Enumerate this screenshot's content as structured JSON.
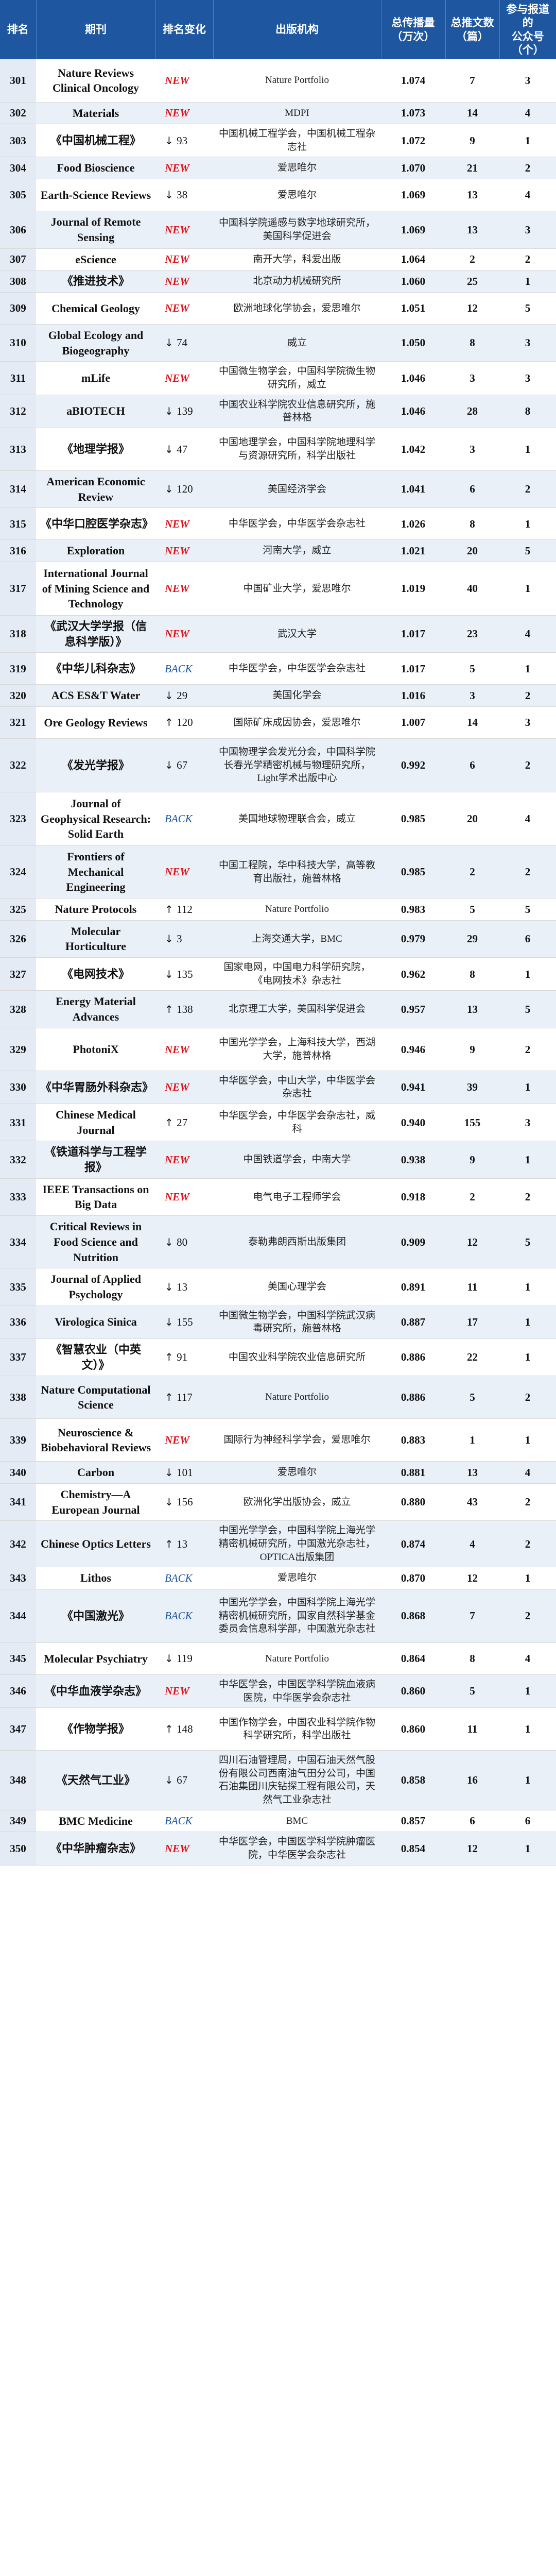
{
  "header": {
    "rank": "排名",
    "journal": "期刊",
    "change": "排名变化",
    "publisher": "出版机构",
    "score": "总传播量\n（万次）",
    "count": "总推文数\n（篇）",
    "accounts": "参与报道的\n公众号\n（个）"
  },
  "rows": [
    {
      "rank": "301",
      "journal": "Nature Reviews Clinical Oncology",
      "change_type": "new",
      "change_text": "NEW",
      "publisher": "Nature Portfolio",
      "score": "1.074",
      "count": "7",
      "accounts": "3"
    },
    {
      "rank": "302",
      "journal": "Materials",
      "change_type": "new",
      "change_text": "NEW",
      "publisher": "MDPI",
      "score": "1.073",
      "count": "14",
      "accounts": "4"
    },
    {
      "rank": "303",
      "journal": "《中国机械工程》",
      "change_type": "down",
      "change_text": "93",
      "publisher": "中国机械工程学会，中国机械工程杂志社",
      "score": "1.072",
      "count": "9",
      "accounts": "1"
    },
    {
      "rank": "304",
      "journal": "Food Bioscience",
      "change_type": "new",
      "change_text": "NEW",
      "publisher": "爱思唯尔",
      "score": "1.070",
      "count": "21",
      "accounts": "2"
    },
    {
      "rank": "305",
      "journal": "Earth-Science Reviews",
      "change_type": "down",
      "change_text": "38",
      "publisher": "爱思唯尔",
      "score": "1.069",
      "count": "13",
      "accounts": "4"
    },
    {
      "rank": "306",
      "journal": "Journal of Remote Sensing",
      "change_type": "new",
      "change_text": "NEW",
      "publisher": "中国科学院遥感与数字地球研究所，美国科学促进会",
      "score": "1.069",
      "count": "13",
      "accounts": "3"
    },
    {
      "rank": "307",
      "journal": "eScience",
      "change_type": "new",
      "change_text": "NEW",
      "publisher": "南开大学，科爱出版",
      "score": "1.064",
      "count": "2",
      "accounts": "2"
    },
    {
      "rank": "308",
      "journal": "《推进技术》",
      "change_type": "new",
      "change_text": "NEW",
      "publisher": "北京动力机械研究所",
      "score": "1.060",
      "count": "25",
      "accounts": "1"
    },
    {
      "rank": "309",
      "journal": "Chemical Geology",
      "change_type": "new",
      "change_text": "NEW",
      "publisher": "欧洲地球化学协会，爱思唯尔",
      "score": "1.051",
      "count": "12",
      "accounts": "5"
    },
    {
      "rank": "310",
      "journal": "Global Ecology and Biogeography",
      "change_type": "down",
      "change_text": "74",
      "publisher": "威立",
      "score": "1.050",
      "count": "8",
      "accounts": "3"
    },
    {
      "rank": "311",
      "journal": "mLife",
      "change_type": "new",
      "change_text": "NEW",
      "publisher": "中国微生物学会，中国科学院微生物研究所，威立",
      "score": "1.046",
      "count": "3",
      "accounts": "3"
    },
    {
      "rank": "312",
      "journal": "aBIOTECH",
      "change_type": "down",
      "change_text": "139",
      "publisher": "中国农业科学院农业信息研究所，施普林格",
      "score": "1.046",
      "count": "28",
      "accounts": "8"
    },
    {
      "rank": "313",
      "journal": "《地理学报》",
      "change_type": "down",
      "change_text": "47",
      "publisher": "中国地理学会，中国科学院地理科学与资源研究所，科学出版社",
      "score": "1.042",
      "count": "3",
      "accounts": "1"
    },
    {
      "rank": "314",
      "journal": "American Economic Review",
      "change_type": "down",
      "change_text": "120",
      "publisher": "美国经济学会",
      "score": "1.041",
      "count": "6",
      "accounts": "2"
    },
    {
      "rank": "315",
      "journal": "《中华口腔医学杂志》",
      "change_type": "new",
      "change_text": "NEW",
      "publisher": "中华医学会，中华医学会杂志社",
      "score": "1.026",
      "count": "8",
      "accounts": "1"
    },
    {
      "rank": "316",
      "journal": "Exploration",
      "change_type": "new",
      "change_text": "NEW",
      "publisher": "河南大学，威立",
      "score": "1.021",
      "count": "20",
      "accounts": "5"
    },
    {
      "rank": "317",
      "journal": "International Journal of Mining Science and Technology",
      "change_type": "new",
      "change_text": "NEW",
      "publisher": "中国矿业大学，爱思唯尔",
      "score": "1.019",
      "count": "40",
      "accounts": "1"
    },
    {
      "rank": "318",
      "journal": "《武汉大学学报（信息科学版）》",
      "change_type": "new",
      "change_text": "NEW",
      "publisher": "武汉大学",
      "score": "1.017",
      "count": "23",
      "accounts": "4"
    },
    {
      "rank": "319",
      "journal": "《中华儿科杂志》",
      "change_type": "back",
      "change_text": "BACK",
      "publisher": "中华医学会，中华医学会杂志社",
      "score": "1.017",
      "count": "5",
      "accounts": "1"
    },
    {
      "rank": "320",
      "journal": "ACS ES&T Water",
      "change_type": "down",
      "change_text": "29",
      "publisher": "美国化学会",
      "score": "1.016",
      "count": "3",
      "accounts": "2"
    },
    {
      "rank": "321",
      "journal": "Ore Geology Reviews",
      "change_type": "up",
      "change_text": "120",
      "publisher": "国际矿床成因协会，爱思唯尔",
      "score": "1.007",
      "count": "14",
      "accounts": "3"
    },
    {
      "rank": "322",
      "journal": "《发光学报》",
      "change_type": "down",
      "change_text": "67",
      "publisher": "中国物理学会发光分会，中国科学院长春光学精密机械与物理研究所，Light学术出版中心",
      "score": "0.992",
      "count": "6",
      "accounts": "2"
    },
    {
      "rank": "323",
      "journal": "Journal of Geophysical Research: Solid Earth",
      "change_type": "back",
      "change_text": "BACK",
      "publisher": "美国地球物理联合会，威立",
      "score": "0.985",
      "count": "20",
      "accounts": "4"
    },
    {
      "rank": "324",
      "journal": "Frontiers of Mechanical Engineering",
      "change_type": "new",
      "change_text": "NEW",
      "publisher": "中国工程院，华中科技大学，高等教育出版社，施普林格",
      "score": "0.985",
      "count": "2",
      "accounts": "2"
    },
    {
      "rank": "325",
      "journal": "Nature Protocols",
      "change_type": "up",
      "change_text": "112",
      "publisher": "Nature Portfolio",
      "score": "0.983",
      "count": "5",
      "accounts": "5"
    },
    {
      "rank": "326",
      "journal": "Molecular Horticulture",
      "change_type": "down",
      "change_text": "3",
      "publisher": "上海交通大学，BMC",
      "score": "0.979",
      "count": "29",
      "accounts": "6"
    },
    {
      "rank": "327",
      "journal": "《电网技术》",
      "change_type": "down",
      "change_text": "135",
      "publisher": "国家电网，中国电力科学研究院，《电网技术》杂志社",
      "score": "0.962",
      "count": "8",
      "accounts": "1"
    },
    {
      "rank": "328",
      "journal": "Energy Material Advances",
      "change_type": "up",
      "change_text": "138",
      "publisher": "北京理工大学，美国科学促进会",
      "score": "0.957",
      "count": "13",
      "accounts": "5"
    },
    {
      "rank": "329",
      "journal": "PhotoniX",
      "change_type": "new",
      "change_text": "NEW",
      "publisher": "中国光学学会，上海科技大学，西湖大学，施普林格",
      "score": "0.946",
      "count": "9",
      "accounts": "2"
    },
    {
      "rank": "330",
      "journal": "《中华胃肠外科杂志》",
      "change_type": "new",
      "change_text": "NEW",
      "publisher": "中华医学会，中山大学，中华医学会杂志社",
      "score": "0.941",
      "count": "39",
      "accounts": "1"
    },
    {
      "rank": "331",
      "journal": "Chinese Medical Journal",
      "change_type": "up",
      "change_text": "27",
      "publisher": "中华医学会，中华医学会杂志社，威科",
      "score": "0.940",
      "count": "155",
      "accounts": "3"
    },
    {
      "rank": "332",
      "journal": "《铁道科学与工程学报》",
      "change_type": "new",
      "change_text": "NEW",
      "publisher": "中国铁道学会，中南大学",
      "score": "0.938",
      "count": "9",
      "accounts": "1"
    },
    {
      "rank": "333",
      "journal": "IEEE Transactions on Big Data",
      "change_type": "new",
      "change_text": "NEW",
      "publisher": "电气电子工程师学会",
      "score": "0.918",
      "count": "2",
      "accounts": "2"
    },
    {
      "rank": "334",
      "journal": "Critical Reviews in Food Science and Nutrition",
      "change_type": "down",
      "change_text": "80",
      "publisher": "泰勒弗朗西斯出版集团",
      "score": "0.909",
      "count": "12",
      "accounts": "5"
    },
    {
      "rank": "335",
      "journal": "Journal of Applied Psychology",
      "change_type": "down",
      "change_text": "13",
      "publisher": "美国心理学会",
      "score": "0.891",
      "count": "11",
      "accounts": "1"
    },
    {
      "rank": "336",
      "journal": "Virologica Sinica",
      "change_type": "down",
      "change_text": "155",
      "publisher": "中国微生物学会，中国科学院武汉病毒研究所，施普林格",
      "score": "0.887",
      "count": "17",
      "accounts": "1"
    },
    {
      "rank": "337",
      "journal": "《智慧农业（中英文）》",
      "change_type": "up",
      "change_text": "91",
      "publisher": "中国农业科学院农业信息研究所",
      "score": "0.886",
      "count": "22",
      "accounts": "1"
    },
    {
      "rank": "338",
      "journal": "Nature Computational Science",
      "change_type": "up",
      "change_text": "117",
      "publisher": "Nature Portfolio",
      "score": "0.886",
      "count": "5",
      "accounts": "2"
    },
    {
      "rank": "339",
      "journal": "Neuroscience & Biobehavioral Reviews",
      "change_type": "new",
      "change_text": "NEW",
      "publisher": "国际行为神经科学学会，爱思唯尔",
      "score": "0.883",
      "count": "1",
      "accounts": "1"
    },
    {
      "rank": "340",
      "journal": "Carbon",
      "change_type": "down",
      "change_text": "101",
      "publisher": "爱思唯尔",
      "score": "0.881",
      "count": "13",
      "accounts": "4"
    },
    {
      "rank": "341",
      "journal": "Chemistry—A European Journal",
      "change_type": "down",
      "change_text": "156",
      "publisher": "欧洲化学出版协会，威立",
      "score": "0.880",
      "count": "43",
      "accounts": "2"
    },
    {
      "rank": "342",
      "journal": "Chinese Optics Letters",
      "change_type": "up",
      "change_text": "13",
      "publisher": "中国光学学会，中国科学院上海光学精密机械研究所，中国激光杂志社，OPTICA出版集团",
      "score": "0.874",
      "count": "4",
      "accounts": "2"
    },
    {
      "rank": "343",
      "journal": "Lithos",
      "change_type": "back",
      "change_text": "BACK",
      "publisher": "爱思唯尔",
      "score": "0.870",
      "count": "12",
      "accounts": "1"
    },
    {
      "rank": "344",
      "journal": "《中国激光》",
      "change_type": "back",
      "change_text": "BACK",
      "publisher": "中国光学学会，中国科学院上海光学精密机械研究所，国家自然科学基金委员会信息科学部，中国激光杂志社",
      "score": "0.868",
      "count": "7",
      "accounts": "2"
    },
    {
      "rank": "345",
      "journal": "Molecular Psychiatry",
      "change_type": "down",
      "change_text": "119",
      "publisher": "Nature Portfolio",
      "score": "0.864",
      "count": "8",
      "accounts": "4"
    },
    {
      "rank": "346",
      "journal": "《中华血液学杂志》",
      "change_type": "new",
      "change_text": "NEW",
      "publisher": "中华医学会，中国医学科学院血液病医院，中华医学会杂志社",
      "score": "0.860",
      "count": "5",
      "accounts": "1"
    },
    {
      "rank": "347",
      "journal": "《作物学报》",
      "change_type": "up",
      "change_text": "148",
      "publisher": "中国作物学会，中国农业科学院作物科学研究所，科学出版社",
      "score": "0.860",
      "count": "11",
      "accounts": "1"
    },
    {
      "rank": "348",
      "journal": "《天然气工业》",
      "change_type": "down",
      "change_text": "67",
      "publisher": "四川石油管理局，中国石油天然气股份有限公司西南油气田分公司，中国石油集团川庆钻探工程有限公司，天然气工业杂志社",
      "score": "0.858",
      "count": "16",
      "accounts": "1"
    },
    {
      "rank": "349",
      "journal": "BMC Medicine",
      "change_type": "back",
      "change_text": "BACK",
      "publisher": "BMC",
      "score": "0.857",
      "count": "6",
      "accounts": "6"
    },
    {
      "rank": "350",
      "journal": "《中华肿瘤杂志》",
      "change_type": "new",
      "change_text": "NEW",
      "publisher": "中华医学会，中国医学科学院肿瘤医院，中华医学会杂志社",
      "score": "0.854",
      "count": "12",
      "accounts": "1"
    }
  ]
}
